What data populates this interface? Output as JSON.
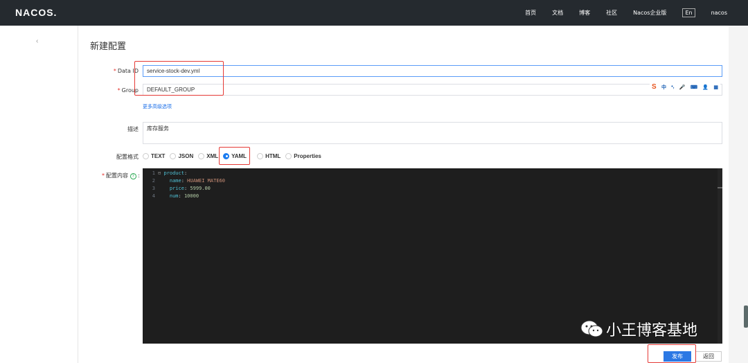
{
  "header": {
    "logo": "NACOS.",
    "nav": [
      "首页",
      "文档",
      "博客",
      "社区",
      "Nacos企业版",
      "En",
      "nacos"
    ]
  },
  "sidebar": {
    "back_glyph": "‹"
  },
  "page": {
    "title": "新建配置"
  },
  "form": {
    "data_id_label": "Data ID",
    "data_id_value": "service-stock-dev.yml",
    "group_label": "Group",
    "group_value": "DEFAULT_GROUP",
    "advanced_link": "更多高级选项",
    "desc_label": "描述",
    "desc_value": "库存服务",
    "format_label": "配置格式",
    "formats": [
      "TEXT",
      "JSON",
      "XML",
      "YAML",
      "HTML",
      "Properties"
    ],
    "selected_format": "YAML",
    "content_label": "配置内容",
    "help_glyph": "?",
    "colon": ":"
  },
  "editor": {
    "lines": [
      {
        "n": "1",
        "key": "product",
        "sep": ":",
        "val": "",
        "type": "",
        "indent": "",
        "fold": "⊟ "
      },
      {
        "n": "2",
        "key": "name",
        "sep": ": ",
        "val": "HUAWEI MATE60",
        "type": "str",
        "indent": "  ",
        "fold": ""
      },
      {
        "n": "3",
        "key": "price",
        "sep": ": ",
        "val": "5999.00",
        "type": "num",
        "indent": "  ",
        "fold": ""
      },
      {
        "n": "4",
        "key": "num",
        "sep": ": ",
        "val": "10000",
        "type": "num",
        "indent": "  ",
        "fold": ""
      }
    ]
  },
  "ime": {
    "items": [
      "S",
      "中",
      "•,",
      "🎤",
      "⌨",
      "👤",
      "▦"
    ]
  },
  "actions": {
    "publish": "发布",
    "back": "返回"
  },
  "watermark": {
    "text": "小王博客基地"
  },
  "colors": {
    "primary": "#2b78e4",
    "topbar": "#252a2f",
    "highlight": "#e53935"
  }
}
